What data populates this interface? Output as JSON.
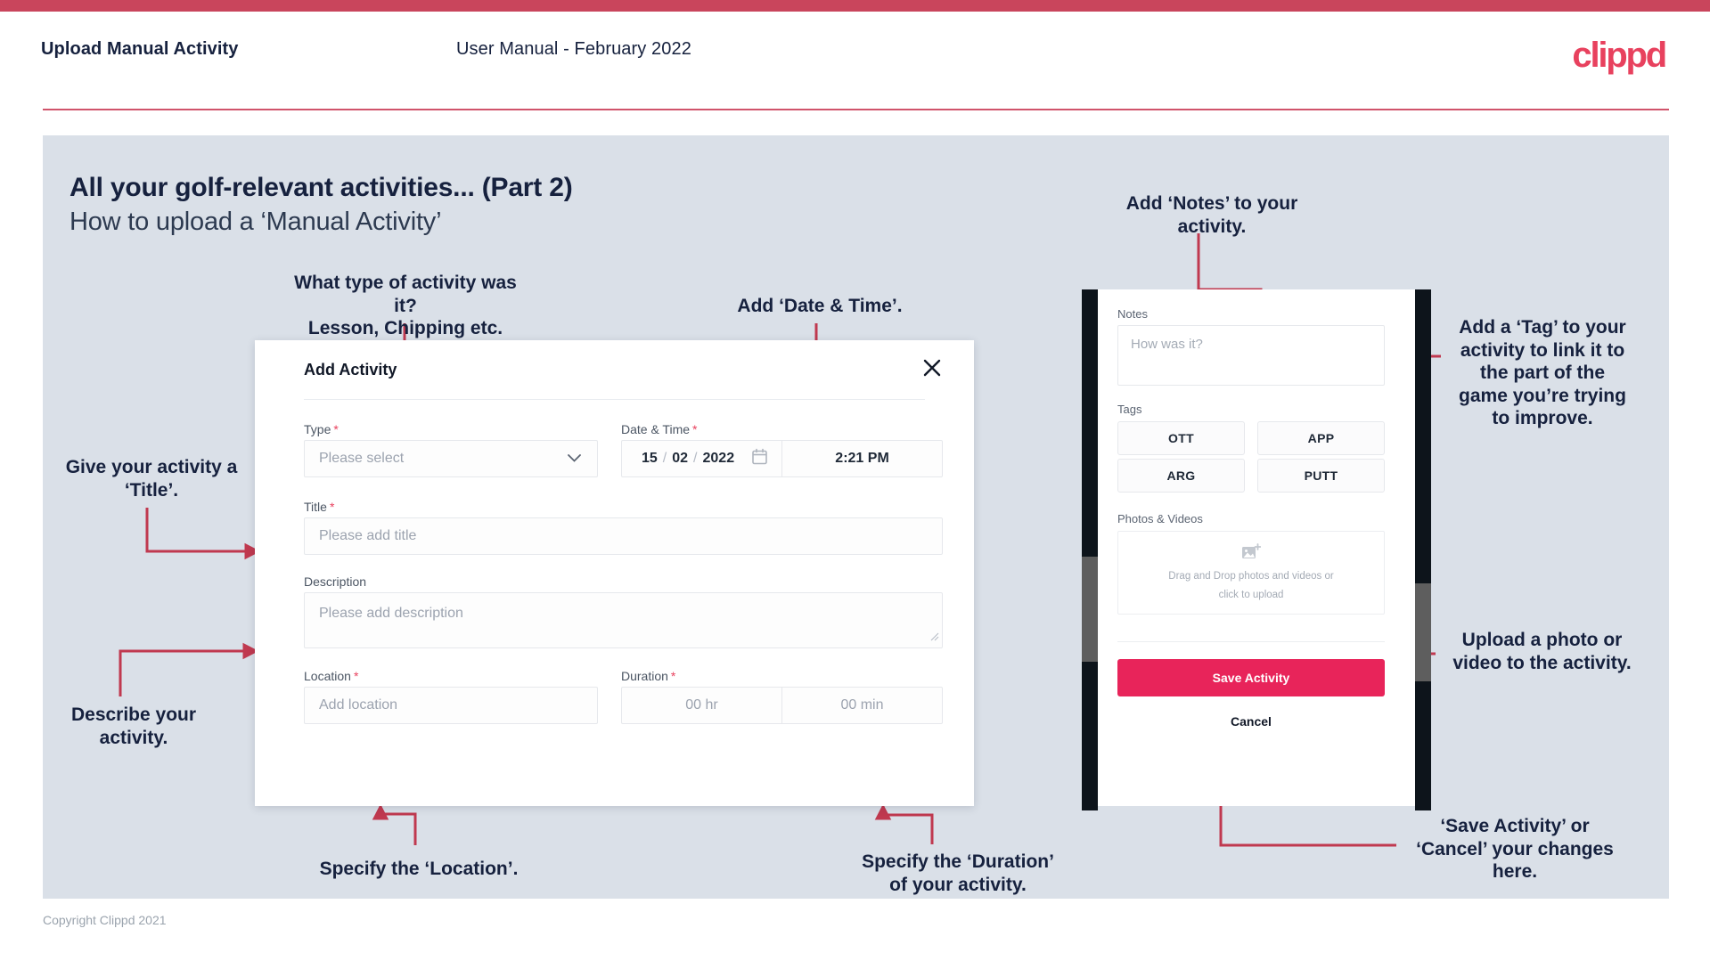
{
  "theme": {
    "band": "#c9455c",
    "brand_pink": "#e8415e",
    "panel_bg": "#dae0e8",
    "ink": "#16213e",
    "save_btn": "#e8245a",
    "connector": "#c0394f"
  },
  "header": {
    "title": "Upload Manual Activity",
    "subtitle": "User Manual - February 2022",
    "logo_text": "clippd"
  },
  "deck": {
    "title": "All your golf-relevant activities... (Part 2)",
    "subtitle": "How to upload a ‘Manual Activity’"
  },
  "footer": {
    "copyright": "Copyright Clippd 2021"
  },
  "dialog": {
    "title": "Add Activity",
    "close_icon": "close-icon",
    "fields": {
      "type": {
        "label": "Type",
        "required_mark": "*",
        "placeholder": "Please select",
        "chevron_icon": "chevron-down-icon"
      },
      "datetime": {
        "label": "Date & Time",
        "required_mark": "*",
        "day": "15",
        "sep1": "/",
        "month": "02",
        "sep2": "/",
        "year": "2022",
        "calendar_icon": "calendar-icon",
        "time": "2:21 PM"
      },
      "title": {
        "label": "Title",
        "required_mark": "*",
        "placeholder": "Please add title"
      },
      "description": {
        "label": "Description",
        "placeholder": "Please add description"
      },
      "location": {
        "label": "Location",
        "required_mark": "*",
        "placeholder": "Add location"
      },
      "duration": {
        "label": "Duration",
        "required_mark": "*",
        "hours_placeholder": "00 hr",
        "minutes_placeholder": "00 min"
      }
    }
  },
  "phone": {
    "notes": {
      "label": "Notes",
      "placeholder": "How was it?"
    },
    "tags": {
      "label": "Tags",
      "items": [
        "OTT",
        "APP",
        "ARG",
        "PUTT"
      ]
    },
    "media": {
      "label": "Photos & Videos",
      "icon": "add-image-icon",
      "dropzone_line1": "Drag and Drop photos and videos or",
      "dropzone_line2": "click to upload"
    },
    "actions": {
      "save_label": "Save Activity",
      "cancel_label": "Cancel"
    }
  },
  "annotations": [
    {
      "id": "type",
      "text": "What type of activity was it?\nLesson, Chipping etc."
    },
    {
      "id": "datetime",
      "text": "Add ‘Date & Time’."
    },
    {
      "id": "title",
      "text": "Give your activity a\n‘Title’."
    },
    {
      "id": "describe",
      "text": "Describe your\nactivity."
    },
    {
      "id": "location",
      "text": "Specify the ‘Location’."
    },
    {
      "id": "duration",
      "text": "Specify the ‘Duration’\nof your activity."
    },
    {
      "id": "notes",
      "text": "Add ‘Notes’ to your\nactivity."
    },
    {
      "id": "tag",
      "text": "Add a ‘Tag’ to your\nactivity to link it to\nthe part of the\ngame you’re trying\nto improve."
    },
    {
      "id": "upload",
      "text": "Upload a photo or\nvideo to the activity."
    },
    {
      "id": "savecancel",
      "text": "‘Save Activity’ or\n‘Cancel’ your changes\nhere."
    }
  ]
}
